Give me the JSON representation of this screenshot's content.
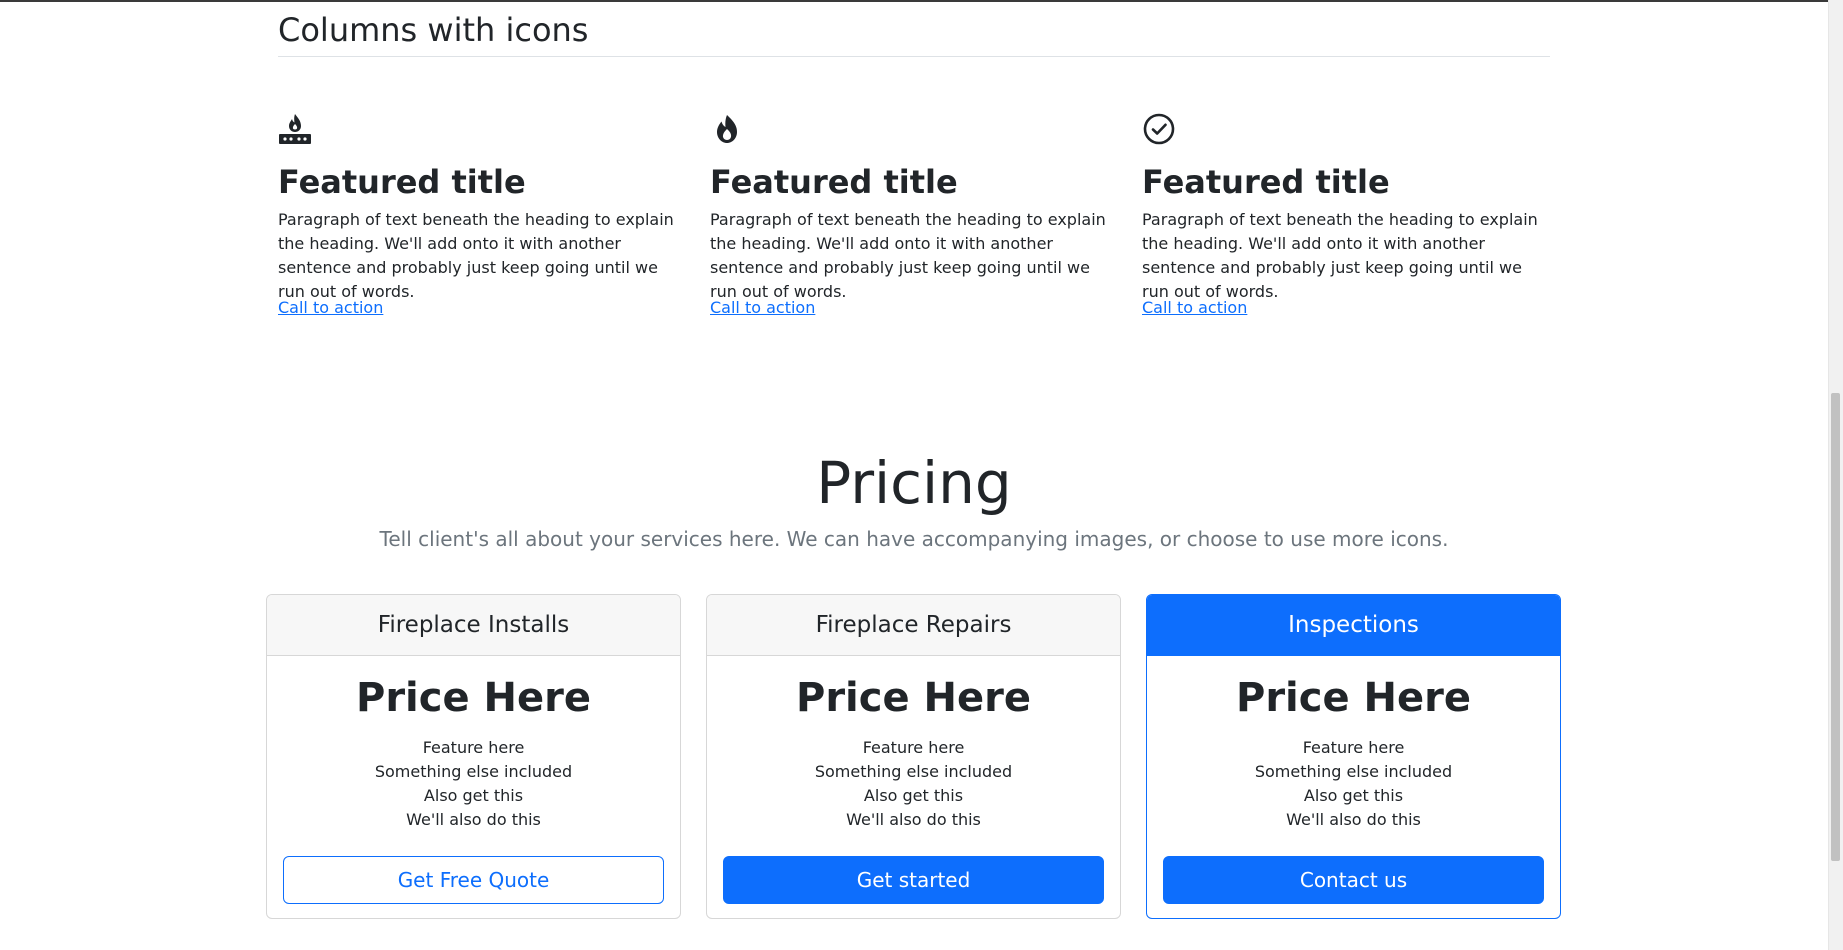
{
  "features_section": {
    "title": "Columns with icons",
    "items": [
      {
        "icon": "fireplace-icon",
        "title": "Featured title",
        "text": "Paragraph of text beneath the heading to explain the heading. We'll add onto it with another sentence and probably just keep going until we run out of words.",
        "link": "Call to action"
      },
      {
        "icon": "fire-icon",
        "title": "Featured title",
        "text": "Paragraph of text beneath the heading to explain the heading. We'll add onto it with another sentence and probably just keep going until we run out of words.",
        "link": "Call to action"
      },
      {
        "icon": "check-circle-icon",
        "title": "Featured title",
        "text": "Paragraph of text beneath the heading to explain the heading. We'll add onto it with another sentence and probably just keep going until we run out of words.",
        "link": "Call to action"
      }
    ]
  },
  "pricing": {
    "title": "Pricing",
    "subtitle": "Tell client's all about your services here. We can have accompanying images, or choose to use more icons.",
    "cards": [
      {
        "header": "Fireplace Installs",
        "price": "Price Here",
        "features": [
          "Feature here",
          "Something else included",
          "Also get this",
          "We'll also do this"
        ],
        "button": "Get Free Quote"
      },
      {
        "header": "Fireplace Repairs",
        "price": "Price Here",
        "features": [
          "Feature here",
          "Something else included",
          "Also get this",
          "We'll also do this"
        ],
        "button": "Get started"
      },
      {
        "header": "Inspections",
        "price": "Price Here",
        "features": [
          "Feature here",
          "Something else included",
          "Also get this",
          "We'll also do this"
        ],
        "button": "Contact us"
      }
    ]
  },
  "colors": {
    "accent": "#0d6efd",
    "text": "#212529",
    "muted": "#6c757d",
    "card_header_bg": "#f7f7f7"
  }
}
